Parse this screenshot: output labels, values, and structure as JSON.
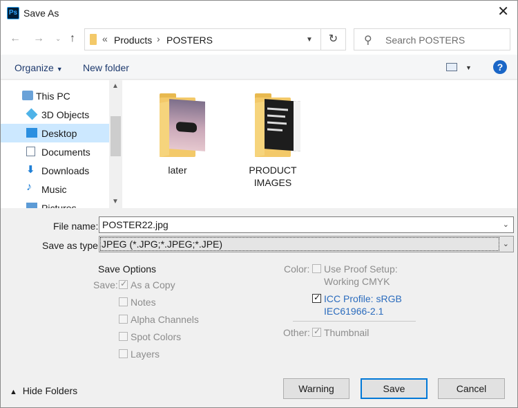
{
  "window": {
    "title": "Save As",
    "app_icon_text": "Ps"
  },
  "nav": {
    "path": [
      "Products",
      "POSTERS"
    ],
    "overflow": "«",
    "search_placeholder": "Search POSTERS"
  },
  "toolbar": {
    "organize": "Organize",
    "new_folder": "New folder",
    "help": "?"
  },
  "tree": {
    "items": [
      {
        "label": "This PC",
        "icon": "computer-icon"
      },
      {
        "label": "3D Objects",
        "icon": "3d-objects-icon"
      },
      {
        "label": "Desktop",
        "icon": "desktop-icon",
        "selected": true
      },
      {
        "label": "Documents",
        "icon": "documents-icon"
      },
      {
        "label": "Downloads",
        "icon": "downloads-icon"
      },
      {
        "label": "Music",
        "icon": "music-icon"
      },
      {
        "label": "Pictures",
        "icon": "pictures-icon"
      }
    ]
  },
  "files": [
    {
      "name": "later"
    },
    {
      "name_line1": "PRODUCT",
      "name_line2": "IMAGES"
    }
  ],
  "form": {
    "file_name_label": "File name:",
    "file_name_value": "POSTER22.jpg",
    "type_label": "Save as type:",
    "type_value": "JPEG (*.JPG;*.JPEG;*.JPE)"
  },
  "options": {
    "title": "Save Options",
    "save_label": "Save:",
    "as_copy": "As a Copy",
    "notes": "Notes",
    "alpha": "Alpha Channels",
    "spot": "Spot Colors",
    "layers": "Layers",
    "color_label": "Color:",
    "proof_line1": "Use Proof Setup:",
    "proof_line2": "Working CMYK",
    "icc_line1": "ICC Profile:  sRGB",
    "icc_line2": "IEC61966-2.1",
    "other_label": "Other:",
    "thumbnail": "Thumbnail"
  },
  "footer": {
    "hide_folders": "Hide Folders",
    "warning": "Warning",
    "save": "Save",
    "cancel": "Cancel"
  },
  "colors": {
    "accent": "#0078d7",
    "selection": "#cce8ff",
    "link": "#2a6bbd"
  }
}
